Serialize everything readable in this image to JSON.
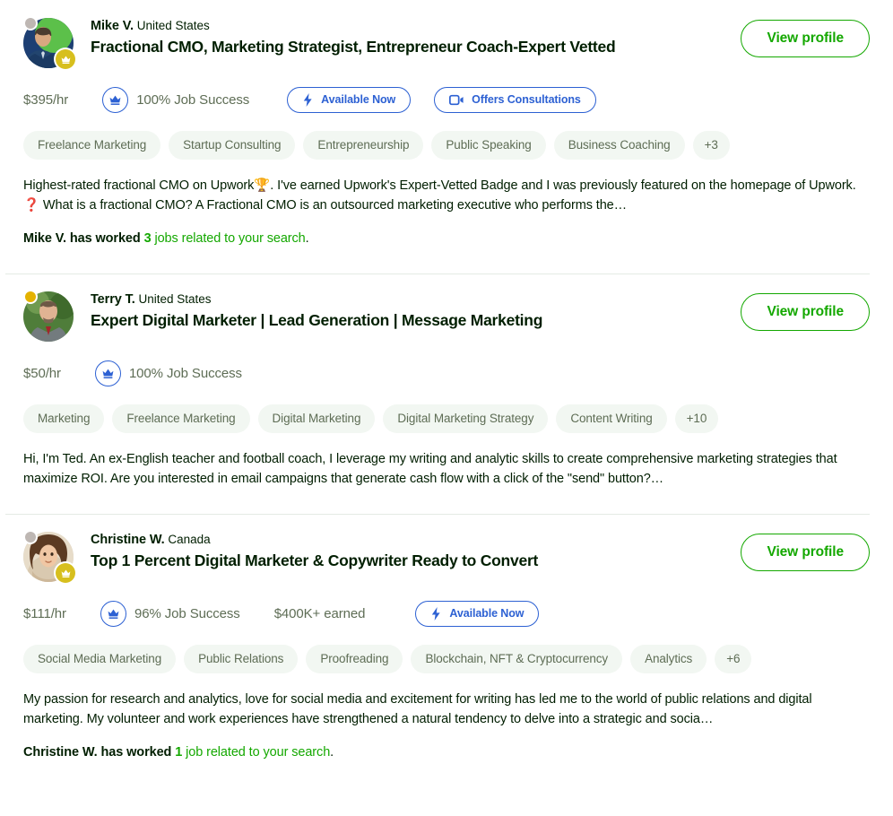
{
  "page": {
    "accent_green": "#14a800",
    "accent_blue": "#2d61d3",
    "text_primary": "#001e00",
    "text_muted": "#5e6d55",
    "tag_bg": "#f2f7f2",
    "divider": "#e4ebe4",
    "crown_badge_bg": "#d7bf1e"
  },
  "freelancers": [
    {
      "name": "Mike V.",
      "country": "United States",
      "title": "Fractional CMO, Marketing Strategist, Entrepreneur Coach-Expert Vetted",
      "rate": "$395/hr",
      "job_success": "100% Job Success",
      "earned": "",
      "status": "offline",
      "top_rated_plus": true,
      "badges": [
        {
          "icon": "bolt-icon",
          "label": "Available Now"
        },
        {
          "icon": "video-camera-icon",
          "label": "Offers Consultations"
        }
      ],
      "tags": [
        "Freelance Marketing",
        "Startup Consulting",
        "Entrepreneurship",
        "Public Speaking",
        "Business Coaching"
      ],
      "more_tags": "+3",
      "description_a": "Highest-rated fractional CMO on Upwork",
      "emoji_a": "🏆",
      "description_b": ". I've earned Upwork's Expert-Vetted Badge and I was previously featured on the homepage of Upwork. ",
      "emoji_b": "❓",
      "description_c": " What is a fractional CMO? A Fractional CMO is an outsourced marketing executive who performs the…",
      "worked_prefix": "Mike V. has worked ",
      "worked_count": "3",
      "worked_suffix": " jobs related to your search",
      "worked_period": ".",
      "view_profile_label": "View profile"
    },
    {
      "name": "Terry T.",
      "country": "United States",
      "title": "Expert Digital Marketer | Lead Generation | Message Marketing",
      "rate": "$50/hr",
      "job_success": "100% Job Success",
      "earned": "",
      "status": "away",
      "top_rated_plus": false,
      "badges": [],
      "tags": [
        "Marketing",
        "Freelance Marketing",
        "Digital Marketing",
        "Digital Marketing Strategy",
        "Content Writing"
      ],
      "more_tags": "+10",
      "description_a": "Hi, I'm Ted. An ex-English teacher and football coach, I leverage my writing and analytic skills to create comprehensive marketing strategies that maximize ROI. Are you interested in email campaigns that generate cash flow with a click of the \"send\" button?…",
      "emoji_a": "",
      "description_b": "",
      "emoji_b": "",
      "description_c": "",
      "worked_prefix": "",
      "worked_count": "",
      "worked_suffix": "",
      "worked_period": "",
      "view_profile_label": "View profile"
    },
    {
      "name": "Christine W.",
      "country": "Canada",
      "title": "Top 1 Percent Digital Marketer & Copywriter Ready to Convert",
      "rate": "$111/hr",
      "job_success": "96% Job Success",
      "earned": "$400K+ earned",
      "status": "offline",
      "top_rated_plus": true,
      "badges": [
        {
          "icon": "bolt-icon",
          "label": "Available Now"
        }
      ],
      "tags": [
        "Social Media Marketing",
        "Public Relations",
        "Proofreading",
        "Blockchain, NFT & Cryptocurrency",
        "Analytics"
      ],
      "more_tags": "+6",
      "description_a": "My passion for research and analytics, love for social media and excitement for writing has led me to the world of public relations and digital marketing. My volunteer and work experiences have strengthened a natural tendency to delve into a strategic and socia…",
      "emoji_a": "",
      "description_b": "",
      "emoji_b": "",
      "description_c": "",
      "worked_prefix": "Christine W. has worked ",
      "worked_count": "1",
      "worked_suffix": " job related to your search",
      "worked_period": ".",
      "view_profile_label": "View profile"
    }
  ]
}
